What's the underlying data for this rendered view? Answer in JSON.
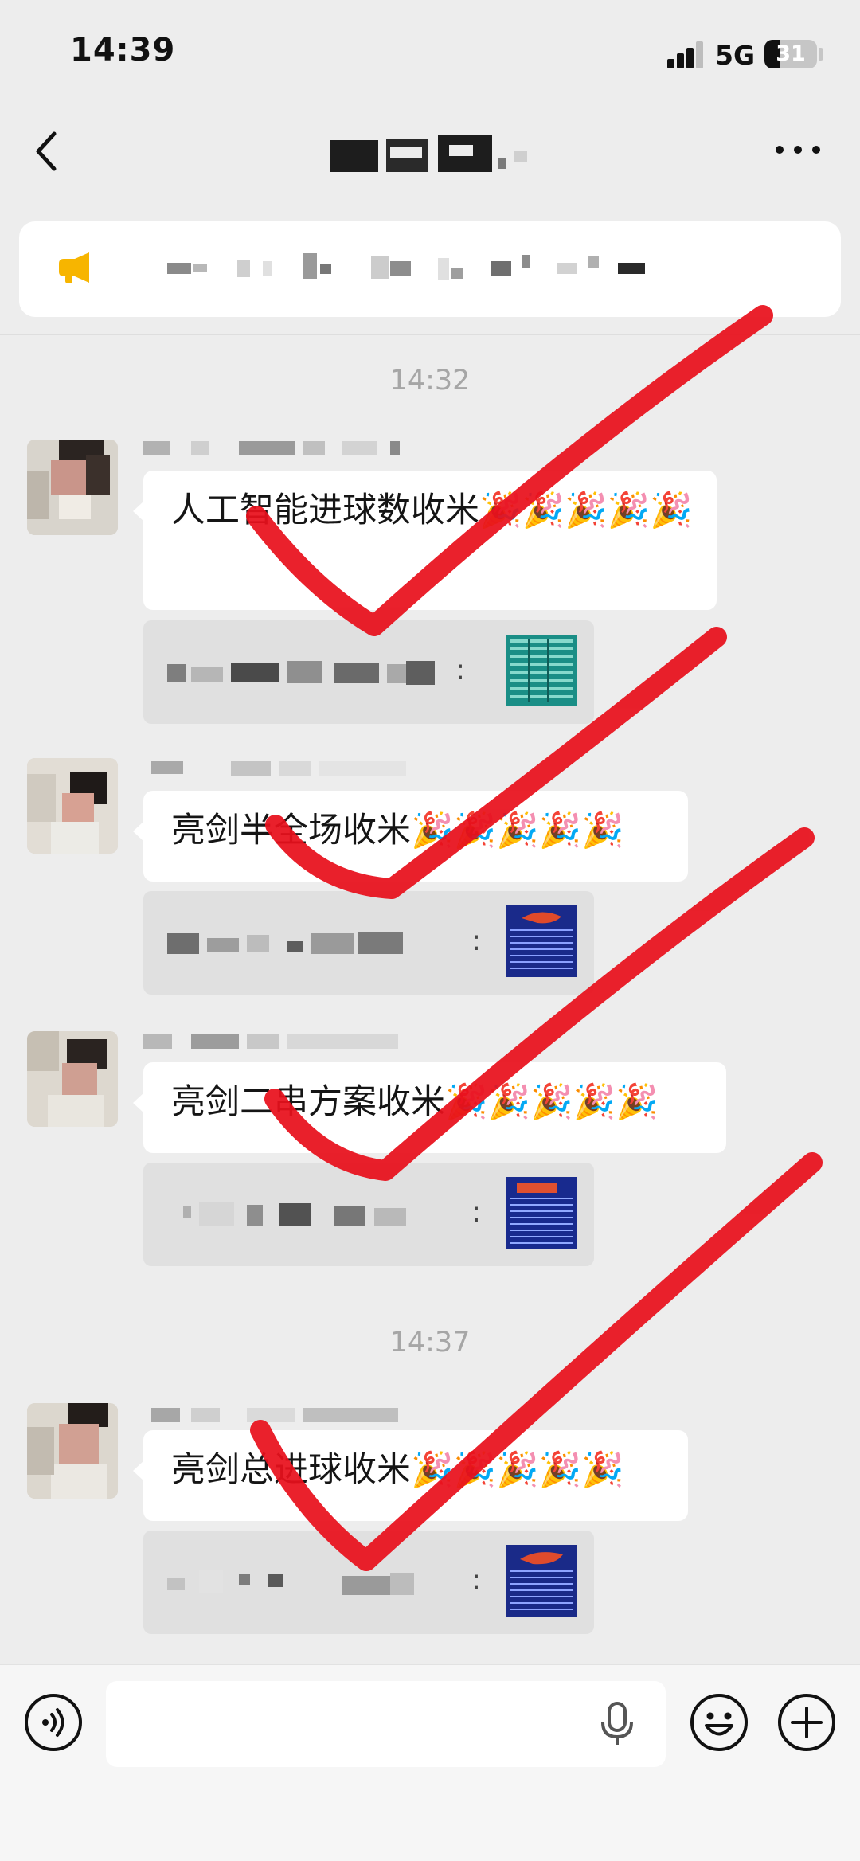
{
  "status_bar": {
    "time": "14:39",
    "network": "5G",
    "battery": "31",
    "battery_fraction": 0.31
  },
  "header": {
    "back_icon": "chevron-left-icon",
    "title": "",
    "more_icon": "more-dots-icon"
  },
  "notice": {
    "icon": "megaphone-icon",
    "text": ""
  },
  "messages": [
    {
      "timestamp": "14:32",
      "sender": "",
      "text": "人工智能进球数收米🎉🎉🎉🎉🎉",
      "quote_label": "",
      "quote_suffix": ":"
    },
    {
      "sender": "",
      "text": "亮剑半全场收米🎉🎉🎉🎉🎉",
      "quote_label": "",
      "quote_suffix": ":"
    },
    {
      "sender": "",
      "text": "亮剑二串方案收米🎉🎉🎉🎉🎉",
      "quote_label": "",
      "quote_suffix": ":"
    },
    {
      "timestamp": "14:37",
      "sender": "",
      "text": "亮剑总进球收米🎉🎉🎉🎉🎉",
      "quote_label": "",
      "quote_suffix": ":"
    }
  ],
  "input_bar": {
    "voice_icon": "voice-icon",
    "message_value": "",
    "mic_icon": "microphone-icon",
    "emoji_icon": "emoji-icon",
    "plus_icon": "plus-icon"
  },
  "overlay": {
    "marks": "red-checkmark",
    "color": "#e8101c"
  },
  "colors": {
    "background": "#ededed",
    "bubble": "#ffffff",
    "quote": "#e0e0e0",
    "timestamp": "#a6a6a6"
  }
}
